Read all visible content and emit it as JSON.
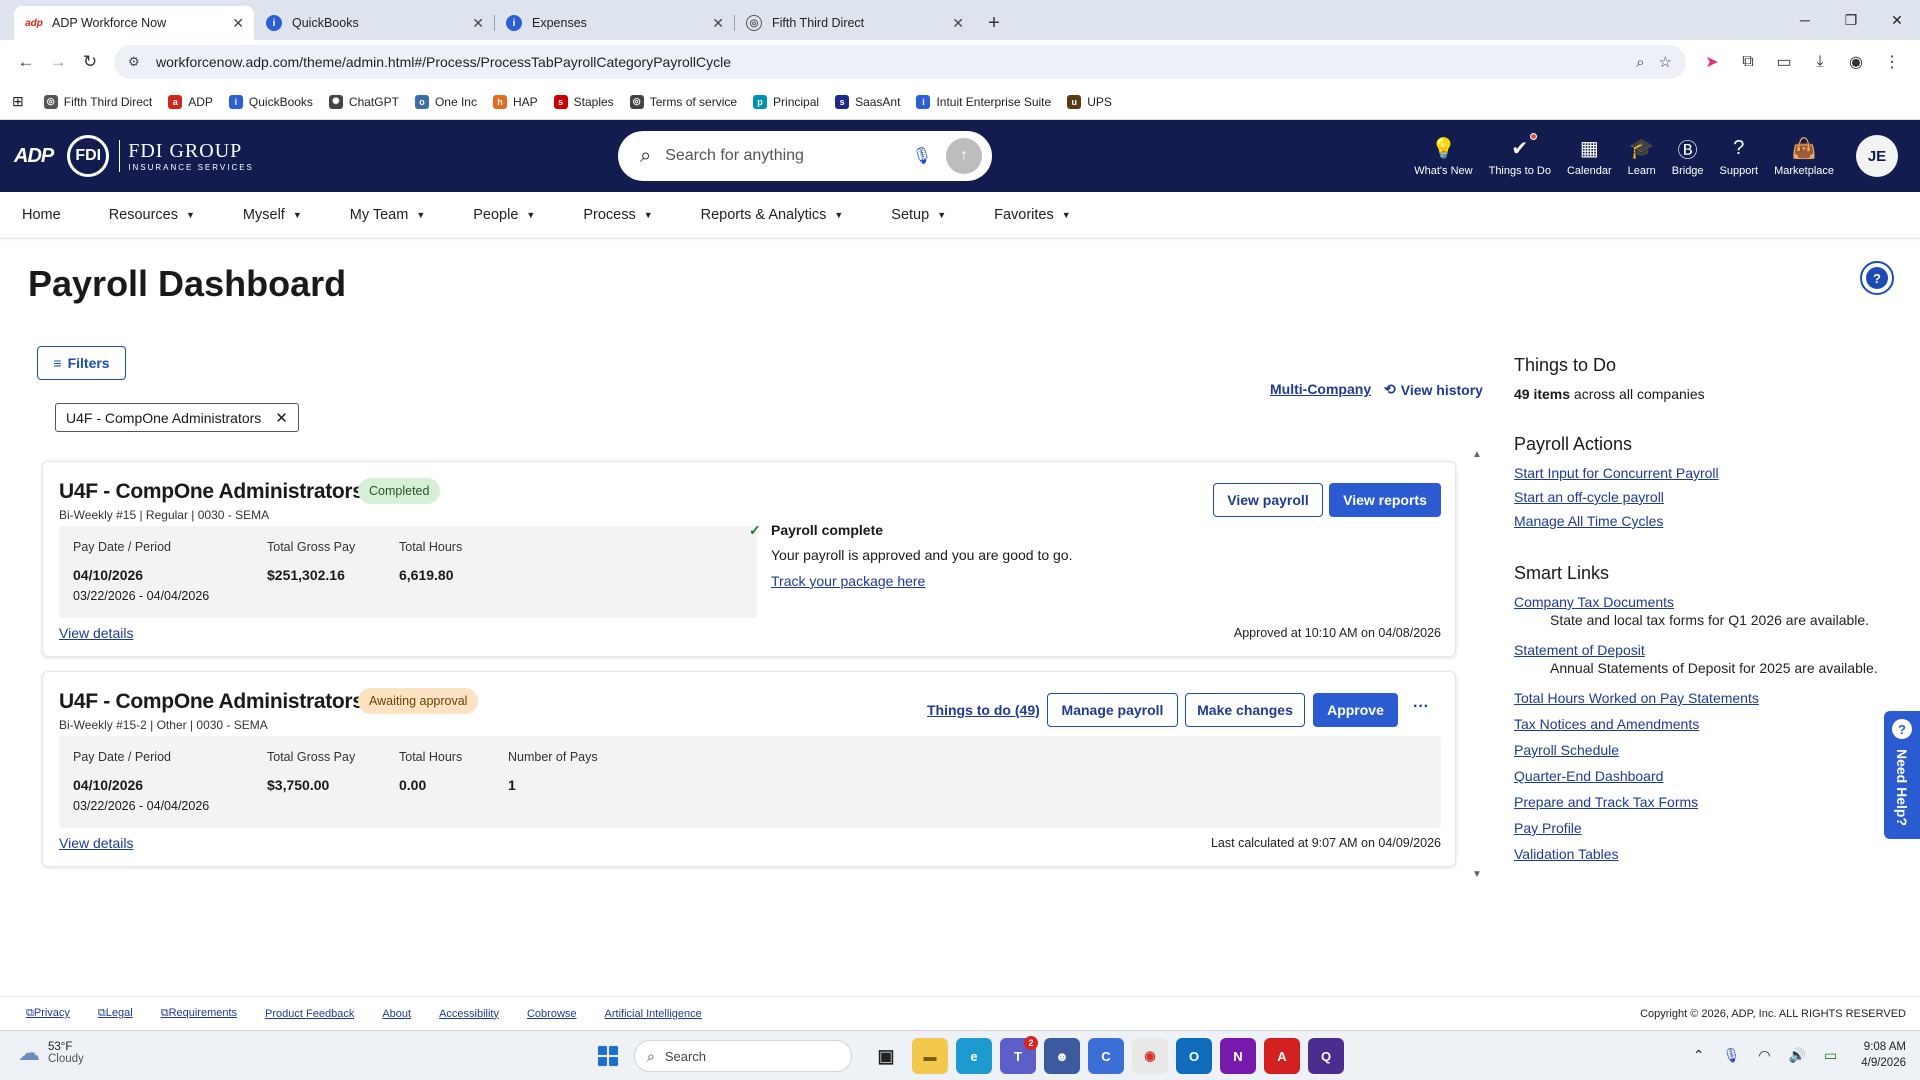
{
  "browser": {
    "tabs": [
      {
        "title": "ADP Workforce Now",
        "icon": "adp-icon",
        "color": "#d0271d",
        "active": true
      },
      {
        "title": "QuickBooks",
        "icon": "intuit-icon",
        "color": "#2b5fd6",
        "active": false
      },
      {
        "title": "Expenses",
        "icon": "intuit-icon",
        "color": "#2b5fd6",
        "active": false
      },
      {
        "title": "Fifth Third Direct",
        "icon": "globe-icon",
        "color": "#555555",
        "active": false
      }
    ],
    "url": "workforcenow.adp.com/theme/admin.html#/Process/ProcessTabPayrollCategoryPayrollCycle",
    "bookmarks": [
      {
        "label": "Fifth Third Direct",
        "color": "#555555"
      },
      {
        "label": "ADP",
        "color": "#d0271d"
      },
      {
        "label": "QuickBooks",
        "color": "#2b5fd6"
      },
      {
        "label": "ChatGPT",
        "color": "#444444"
      },
      {
        "label": "One Inc",
        "color": "#3a6ea5"
      },
      {
        "label": "HAP",
        "color": "#e56b1f"
      },
      {
        "label": "Staples",
        "color": "#cc0000"
      },
      {
        "label": "Terms of service",
        "color": "#444444"
      },
      {
        "label": "Principal",
        "color": "#0091b3"
      },
      {
        "label": "SaasAnt",
        "color": "#1c2a8a"
      },
      {
        "label": "Intuit Enterprise Suite",
        "color": "#2b5fd6"
      },
      {
        "label": "UPS",
        "color": "#5a3a12"
      }
    ]
  },
  "header": {
    "brand": "ADP",
    "company_short": "FDI",
    "company_name": "FDI GROUP",
    "company_tagline": "INSURANCE SERVICES",
    "search_placeholder": "Search for anything",
    "nav": [
      {
        "label": "What's New",
        "icon": "lightbulb-icon"
      },
      {
        "label": "Things to Do",
        "icon": "check-circle-icon"
      },
      {
        "label": "Calendar",
        "icon": "calendar-icon"
      },
      {
        "label": "Learn",
        "icon": "graduation-cap-icon"
      },
      {
        "label": "Bridge",
        "icon": "bridge-icon"
      },
      {
        "label": "Support",
        "icon": "question-icon"
      },
      {
        "label": "Marketplace",
        "icon": "shopping-bag-icon"
      }
    ],
    "avatar_initials": "JE"
  },
  "menu": [
    "Home",
    "Resources",
    "Myself",
    "My Team",
    "People",
    "Process",
    "Reports & Analytics",
    "Setup",
    "Favorites"
  ],
  "page": {
    "title": "Payroll Dashboard",
    "filters_label": "Filters",
    "filter_chip": "U4F - CompOne Administrators",
    "multi_company": "Multi-Company",
    "view_history": "View history"
  },
  "cards": [
    {
      "company": "U4F - CompOne Administrators",
      "status": "Completed",
      "subtitle": "Bi-Weekly #15 | Regular | 0030 - SEMA",
      "pay_date_label": "Pay Date / Period",
      "pay_date": "04/10/2026",
      "period": "03/22/2026 - 04/04/2026",
      "gross_label": "Total Gross Pay",
      "gross": "$251,302.16",
      "hours_label": "Total Hours",
      "hours": "6,619.80",
      "complete_title": "Payroll complete",
      "complete_desc": "Your payroll is approved and you are good to go.",
      "track_link": "Track your package here",
      "btn_view_payroll": "View payroll",
      "btn_view_reports": "View reports",
      "view_details": "View details",
      "stamp": "Approved at 10:10 AM on 04/08/2026"
    },
    {
      "company": "U4F - CompOne Administrators",
      "status": "Awaiting approval",
      "subtitle": "Bi-Weekly #15-2 | Other | 0030 - SEMA",
      "pay_date_label": "Pay Date / Period",
      "pay_date": "04/10/2026",
      "period": "03/22/2026 - 04/04/2026",
      "gross_label": "Total Gross Pay",
      "gross": "$3,750.00",
      "hours_label": "Total Hours",
      "hours": "0.00",
      "pays_label": "Number of Pays",
      "pays": "1",
      "things_to_do": "Things to do (49)",
      "btn_manage": "Manage payroll",
      "btn_changes": "Make changes",
      "btn_approve": "Approve",
      "more": "···",
      "view_details": "View details",
      "stamp": "Last calculated at 9:07 AM on 04/09/2026"
    }
  ],
  "right_panel": {
    "things_title": "Things to Do",
    "things_count_bold": "49 items",
    "things_count_rest": " across all companies",
    "actions_title": "Payroll Actions",
    "actions": [
      "Start Input for Concurrent Payroll",
      "Start an off-cycle payroll",
      "Manage All Time Cycles"
    ],
    "smart_title": "Smart Links",
    "smart_links": [
      {
        "label": "Company Tax Documents",
        "desc": "State and local tax forms for Q1 2026 are available."
      },
      {
        "label": "Statement of Deposit",
        "desc": "Annual Statements of Deposit for 2025 are available."
      },
      {
        "label": "Total Hours Worked on Pay Statements",
        "desc": ""
      },
      {
        "label": "Tax Notices and Amendments",
        "desc": ""
      },
      {
        "label": "Payroll Schedule",
        "desc": ""
      },
      {
        "label": "Quarter-End Dashboard",
        "desc": ""
      },
      {
        "label": "Prepare and Track Tax Forms",
        "desc": ""
      },
      {
        "label": "Pay Profile",
        "desc": ""
      },
      {
        "label": "Validation Tables",
        "desc": ""
      }
    ],
    "need_help": "Need Help?"
  },
  "footer": {
    "links": [
      "Privacy",
      "Legal",
      "Requirements",
      "Product Feedback",
      "About",
      "Accessibility",
      "Cobrowse",
      "Artificial Intelligence"
    ],
    "copyright": "Copyright © 2026, ADP, Inc. ALL RIGHTS RESERVED"
  },
  "taskbar": {
    "temp": "53°F",
    "condition": "Cloudy",
    "search_placeholder": "Search",
    "teams_badge": "2",
    "time": "9:08 AM",
    "date": "4/9/2026"
  },
  "colors": {
    "header_bg": "#121c4e",
    "accent": "#2a5bd1",
    "link": "#1f3a93"
  }
}
